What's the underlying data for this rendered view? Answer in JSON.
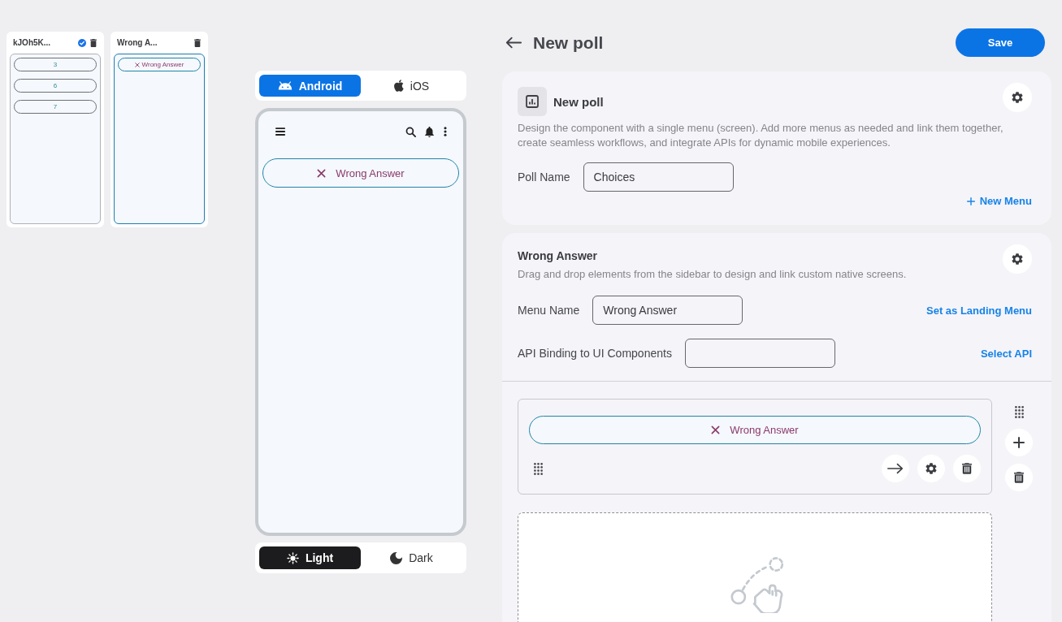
{
  "menus_panel": {
    "menus": [
      {
        "title": "kJOh5K...",
        "landing": true,
        "selected": false,
        "items": [
          {
            "kind": "choice",
            "label": "3"
          },
          {
            "kind": "choice",
            "label": "6"
          },
          {
            "kind": "choice",
            "label": "7"
          }
        ]
      },
      {
        "title": "Wrong A...",
        "landing": false,
        "selected": true,
        "items": [
          {
            "kind": "wrong_answer",
            "label": "Wrong Answer"
          }
        ]
      }
    ]
  },
  "preview": {
    "platforms": [
      {
        "kind": "android",
        "label": "Android",
        "selected": true
      },
      {
        "kind": "ios",
        "label": "iOS",
        "selected": false
      }
    ],
    "screen_items": [
      {
        "kind": "wrong_answer",
        "label": "Wrong Answer"
      }
    ],
    "themes": [
      {
        "kind": "light",
        "label": "Light",
        "selected": true
      },
      {
        "kind": "dark",
        "label": "Dark",
        "selected": false
      }
    ]
  },
  "header": {
    "title": "New poll",
    "save_button": "Save"
  },
  "poll_card": {
    "title": "New poll",
    "description": "Design the component with a single menu (screen). Add more menus as needed and link them together, create seamless workflows, and integrate APIs for dynamic mobile experiences.",
    "poll_name_label": "Poll Name",
    "poll_name_value": "Choices",
    "new_menu_link": "New Menu"
  },
  "menu_card": {
    "title": "Wrong Answer",
    "description": "Drag and drop elements from the sidebar to design and link custom native screens.",
    "menu_name_label": "Menu Name",
    "menu_name_value": "Wrong Answer",
    "landing_link": "Set as Landing Menu",
    "api_label": "API Binding to UI Components",
    "api_link": "Select API",
    "components": [
      {
        "kind": "wrong_answer",
        "label": "Wrong Answer"
      }
    ]
  }
}
